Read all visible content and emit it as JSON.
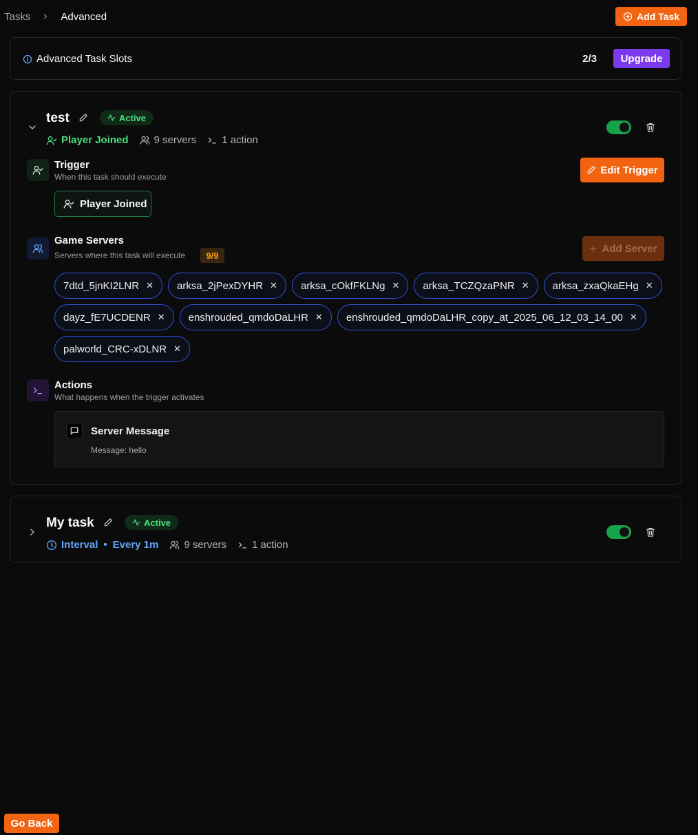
{
  "breadcrumb": {
    "parent": "Tasks",
    "current": "Advanced"
  },
  "header": {
    "add_task": "Add Task"
  },
  "slots": {
    "label": "Advanced Task Slots",
    "count": "2/3",
    "upgrade": "Upgrade"
  },
  "tasks": [
    {
      "name": "test",
      "status": "Active",
      "trigger_meta": "Player Joined",
      "servers_meta": "9 servers",
      "actions_meta": "1 action",
      "enabled": true,
      "trigger": {
        "title": "Trigger",
        "subtitle": "When this task should execute",
        "edit_label": "Edit Trigger",
        "value": "Player Joined"
      },
      "servers": {
        "title": "Game Servers",
        "subtitle": "Servers where this task will execute",
        "count": "9/9",
        "add_label": "Add Server",
        "items": [
          "7dtd_5jnKI2LNR",
          "arksa_2jPexDYHR",
          "arksa_cOkfFKLNg",
          "arksa_TCZQzaPNR",
          "arksa_zxaQkaEHg",
          "dayz_fE7UCDENR",
          "enshrouded_qmdoDaLHR",
          "enshrouded_qmdoDaLHR_copy_at_2025_06_12_03_14_00",
          "palworld_CRC-xDLNR"
        ]
      },
      "actions": {
        "title": "Actions",
        "subtitle": "What happens when the trigger activates",
        "items": [
          {
            "title": "Server Message",
            "message": "Message: hello"
          }
        ]
      }
    },
    {
      "name": "My task",
      "status": "Active",
      "trigger_meta": "Interval",
      "interval": "Every 1m",
      "servers_meta": "9 servers",
      "actions_meta": "1 action",
      "enabled": true
    }
  ],
  "footer": {
    "go_back": "Go Back"
  },
  "colors": {
    "accent": "#f26411",
    "upgrade": "#7c3aed",
    "active": "#4ade80",
    "chip_border": "#2f52d6"
  },
  "icons": [
    "chevron-right-icon",
    "plus-circle-icon",
    "info-icon",
    "chevron-down-icon",
    "pencil-icon",
    "activity-icon",
    "user-check-icon",
    "users-icon",
    "terminal-icon",
    "trash-icon",
    "clock-icon",
    "plus-icon",
    "message-square-icon"
  ]
}
